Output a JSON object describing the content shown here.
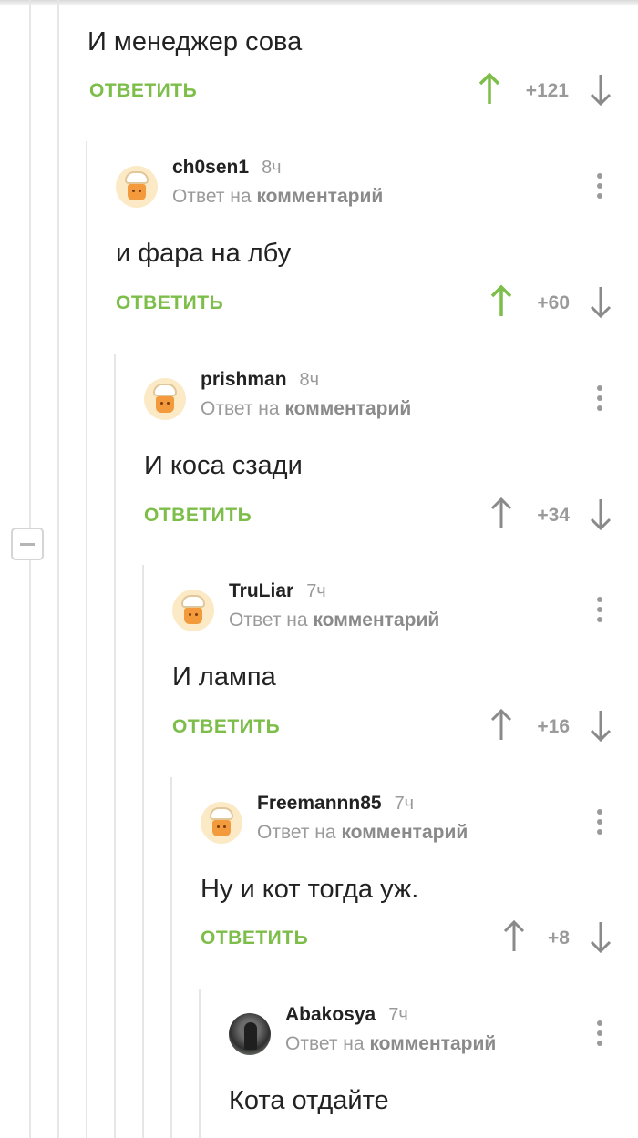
{
  "reply_label": "ОТВЕТИТЬ",
  "reply_prefix": "Ответ на",
  "reply_link": "комментарий",
  "colors": {
    "accent_green": "#7dbe4a",
    "muted": "#9a9a9a"
  },
  "root_comment": {
    "text": "И менеджер сова",
    "rating": "+121",
    "upvoted": true
  },
  "comments": [
    {
      "nick": "ch0sen1",
      "time": "8ч",
      "text": "и фара на лбу",
      "rating": "+60",
      "upvoted": true,
      "avatar": "chef-avatar"
    },
    {
      "nick": "prishman",
      "time": "8ч",
      "text": "И коса сзади",
      "rating": "+34",
      "upvoted": false,
      "avatar": "chef-avatar"
    },
    {
      "nick": "TruLiar",
      "time": "7ч",
      "text": "И лампа",
      "rating": "+16",
      "upvoted": false,
      "avatar": "chef-avatar"
    },
    {
      "nick": "Freemannn85",
      "time": "7ч",
      "text": "Ну и кот тогда уж.",
      "rating": "+8",
      "upvoted": false,
      "avatar": "chef-avatar"
    },
    {
      "nick": "Abakosya",
      "time": "7ч",
      "text": "Кота отдайте",
      "avatar": "photo-avatar"
    }
  ]
}
